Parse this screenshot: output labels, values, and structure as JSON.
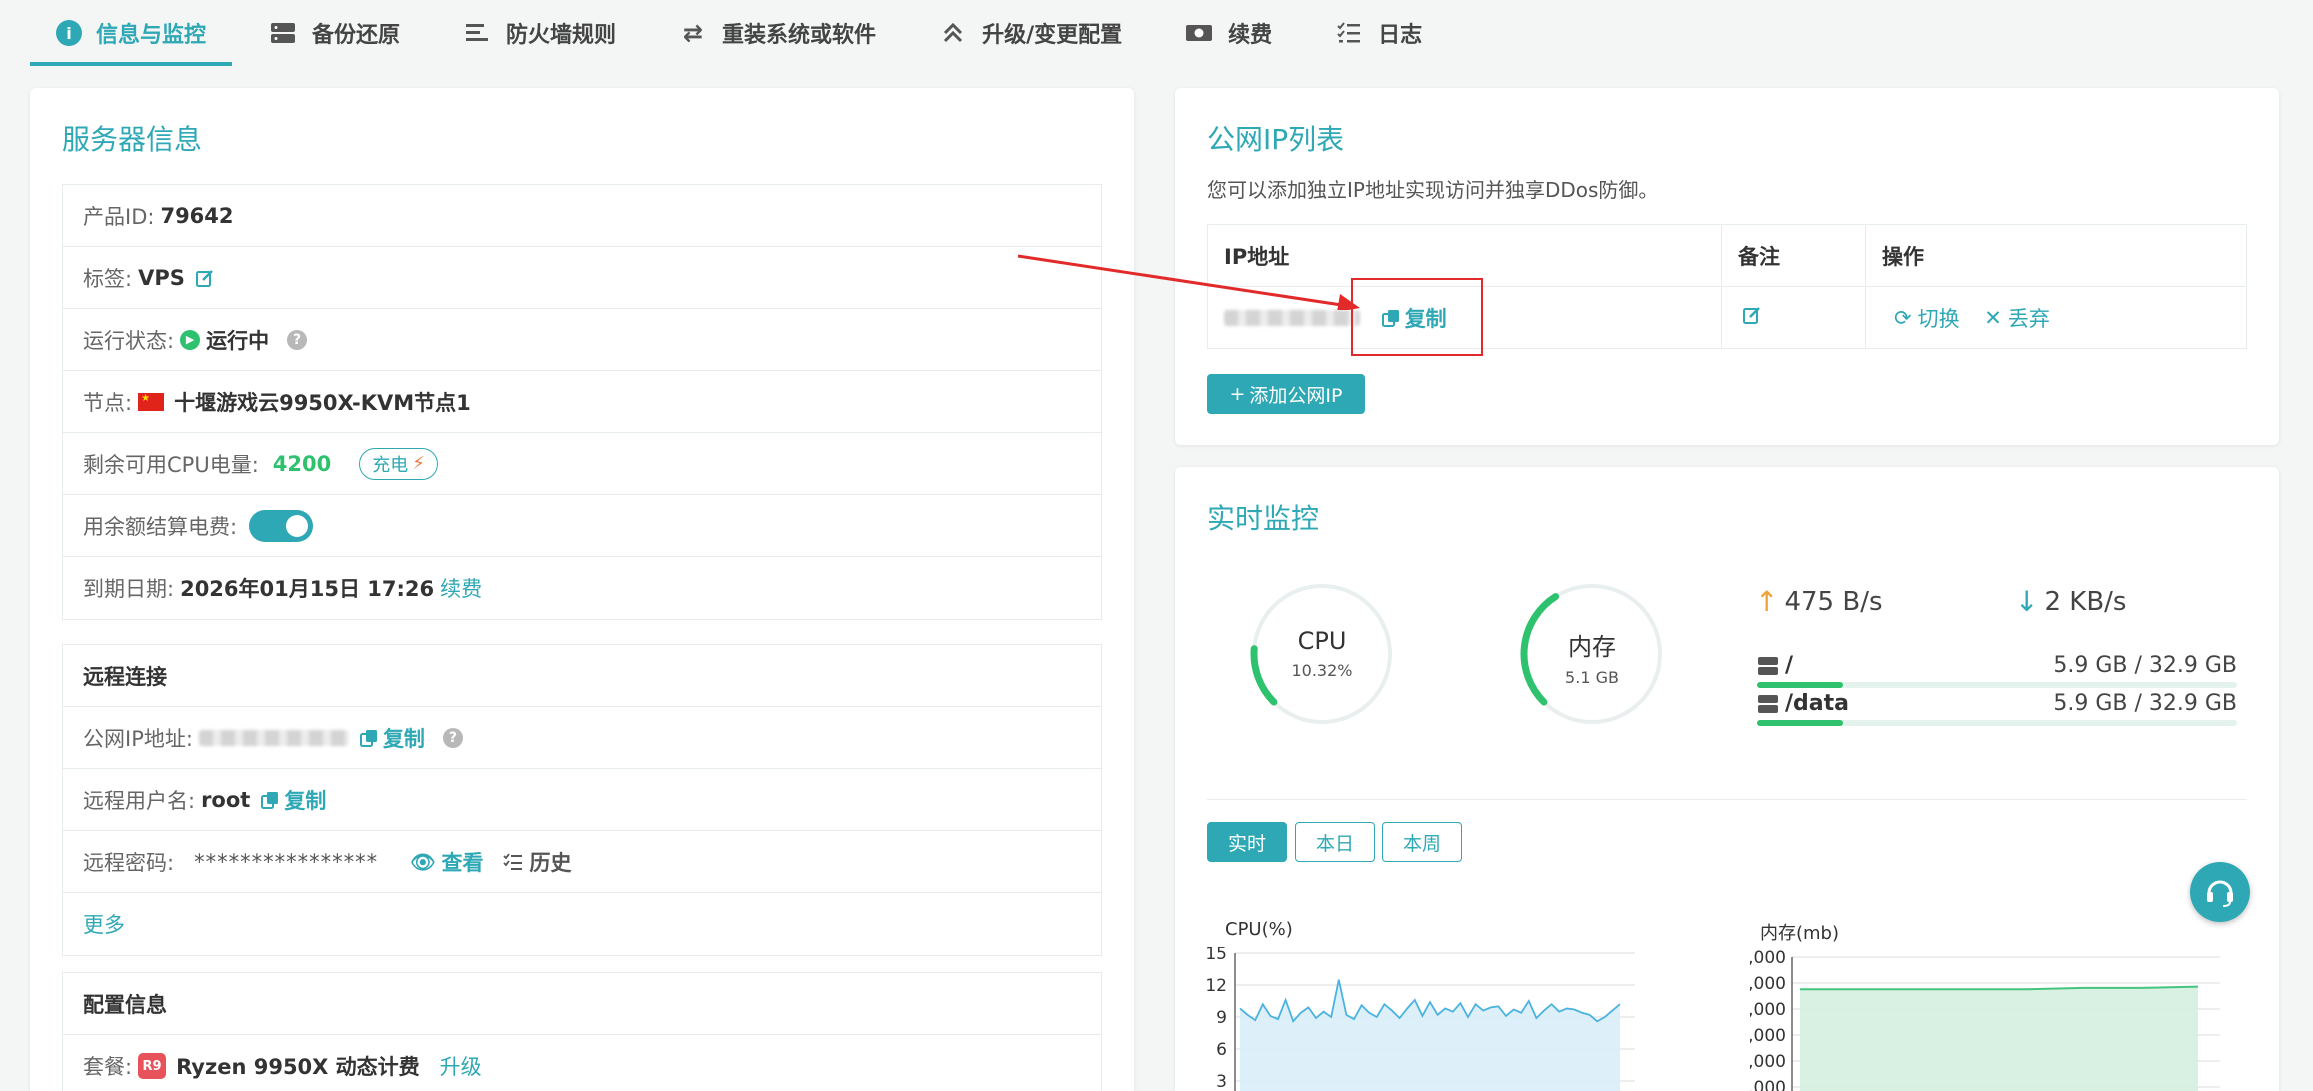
{
  "tabs": [
    {
      "label": "信息与监控",
      "icon": "info-icon"
    },
    {
      "label": "备份还原",
      "icon": "server-icon"
    },
    {
      "label": "防火墙规则",
      "icon": "list-icon"
    },
    {
      "label": "重装系统或软件",
      "icon": "swap-icon"
    },
    {
      "label": "升级/变更配置",
      "icon": "chevron-up-icon"
    },
    {
      "label": "续费",
      "icon": "money-icon"
    },
    {
      "label": "日志",
      "icon": "checklist-icon"
    }
  ],
  "server": {
    "title": "服务器信息",
    "product_label": "产品ID:",
    "product_value": "79642",
    "tag_label": "标签:",
    "tag_value": "VPS",
    "status_label": "运行状态:",
    "status_value": "运行中",
    "node_label": "节点:",
    "node_value": "十堰游戏云9950X-KVM节点1",
    "cpu_power_label": "剩余可用CPU电量:",
    "cpu_power_value": "4200",
    "charge_label": "充电",
    "balance_label": "用余额结算电费:",
    "expire_label": "到期日期:",
    "expire_value": "2026年01月15日 17:26",
    "renew_label": "续费"
  },
  "remote": {
    "title": "远程连接",
    "ip_label": "公网IP地址:",
    "copy_label": "复制",
    "user_label": "远程用户名:",
    "user_value": "root",
    "password_label": "远程密码:",
    "password_value": "****************",
    "view_label": "查看",
    "history_label": "历史",
    "more_label": "更多"
  },
  "config": {
    "title": "配置信息",
    "plan_label": "套餐:",
    "plan_badge": "R9",
    "plan_value": "Ryzen 9950X 动态计费",
    "upgrade_label": "升级"
  },
  "ip_list": {
    "title": "公网IP列表",
    "desc": "您可以添加独立IP地址实现访问并独享DDos防御。",
    "col_ip": "IP地址",
    "col_note": "备注",
    "col_action": "操作",
    "copy_label": "复制",
    "switch_label": "切换",
    "discard_label": "丢弃",
    "add_label": "添加公网IP"
  },
  "monitor": {
    "title": "实时监控",
    "cpu_label": "CPU",
    "cpu_value": "10.32%",
    "cpu_fraction": 0.1032,
    "mem_label": "内存",
    "mem_value": "5.1 GB",
    "mem_fraction": 0.28,
    "upload": "475 B/s",
    "download": "2 KB/s",
    "disks": [
      {
        "name": "/",
        "usage": "5.9 GB / 32.9 GB",
        "fraction": 0.18
      },
      {
        "name": "/data",
        "usage": "5.9 GB / 32.9 GB",
        "fraction": 0.18
      }
    ],
    "ranges": [
      "实时",
      "本日",
      "本周"
    ]
  },
  "chart_data": [
    {
      "type": "area",
      "title": "",
      "ylabel": "CPU(%)",
      "yticks": [
        "15",
        "12",
        "9",
        "6",
        "3"
      ],
      "ylim": [
        3,
        15
      ],
      "y": [
        9.8,
        9.2,
        8.7,
        10.2,
        9.1,
        8.8,
        10.6,
        8.6,
        9.4,
        9.9,
        8.9,
        9.5,
        9.0,
        12.5,
        9.2,
        8.8,
        10.1,
        9.4,
        9.0,
        10.2,
        9.6,
        8.9,
        9.8,
        10.6,
        9.1,
        10.4,
        9.2,
        9.8,
        9.5,
        10.3,
        9.0,
        10.2,
        9.6,
        9.9,
        10.0,
        9.1,
        9.7,
        9.4,
        10.5,
        8.9,
        9.6,
        10.2,
        9.5,
        9.8,
        9.7,
        9.4,
        9.2,
        8.6,
        9.0,
        9.6,
        10.2
      ]
    },
    {
      "type": "area",
      "title": "",
      "ylabel": "内存(mb)",
      "yticks": [
        ",000",
        ",000",
        ",000",
        ",000",
        ",000",
        ",000"
      ],
      "y": [
        0.86,
        0.86,
        0.86,
        0.86,
        0.86,
        0.87,
        0.87,
        0.88
      ]
    }
  ]
}
